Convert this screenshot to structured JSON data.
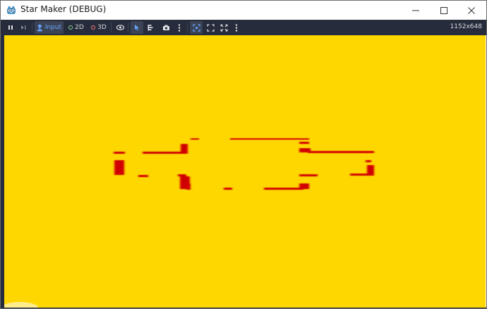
{
  "window": {
    "title": "Star Maker (DEBUG)",
    "icon": "godot-icon"
  },
  "toolbar": {
    "buttons": {
      "pause": "pause-icon",
      "step": "step-icon",
      "input_label": "Input",
      "mode_2d_label": "2D",
      "mode_3d_label": "3D",
      "visibility": "eye-icon",
      "select": "cursor-icon",
      "list": "list-icon",
      "camera": "camera-icon",
      "more1": "kebab-icon",
      "camera_focus": "focus-icon",
      "fit": "fit-icon",
      "expand": "expand-icon",
      "more2": "kebab-icon"
    },
    "resolution": "1152x648"
  },
  "viewport": {
    "background_color": "#ffd700",
    "stroke_color": "#d10000"
  },
  "colors": {
    "toolbar_bg": "#262c3b",
    "active_button_bg": "#3b4456",
    "accent_blue": "#6aa4ff",
    "dot_2d": "#8fd48f",
    "dot_3d": "#ff7b7b",
    "game_yellow": "#ffd700",
    "star_red": "#d10000"
  }
}
